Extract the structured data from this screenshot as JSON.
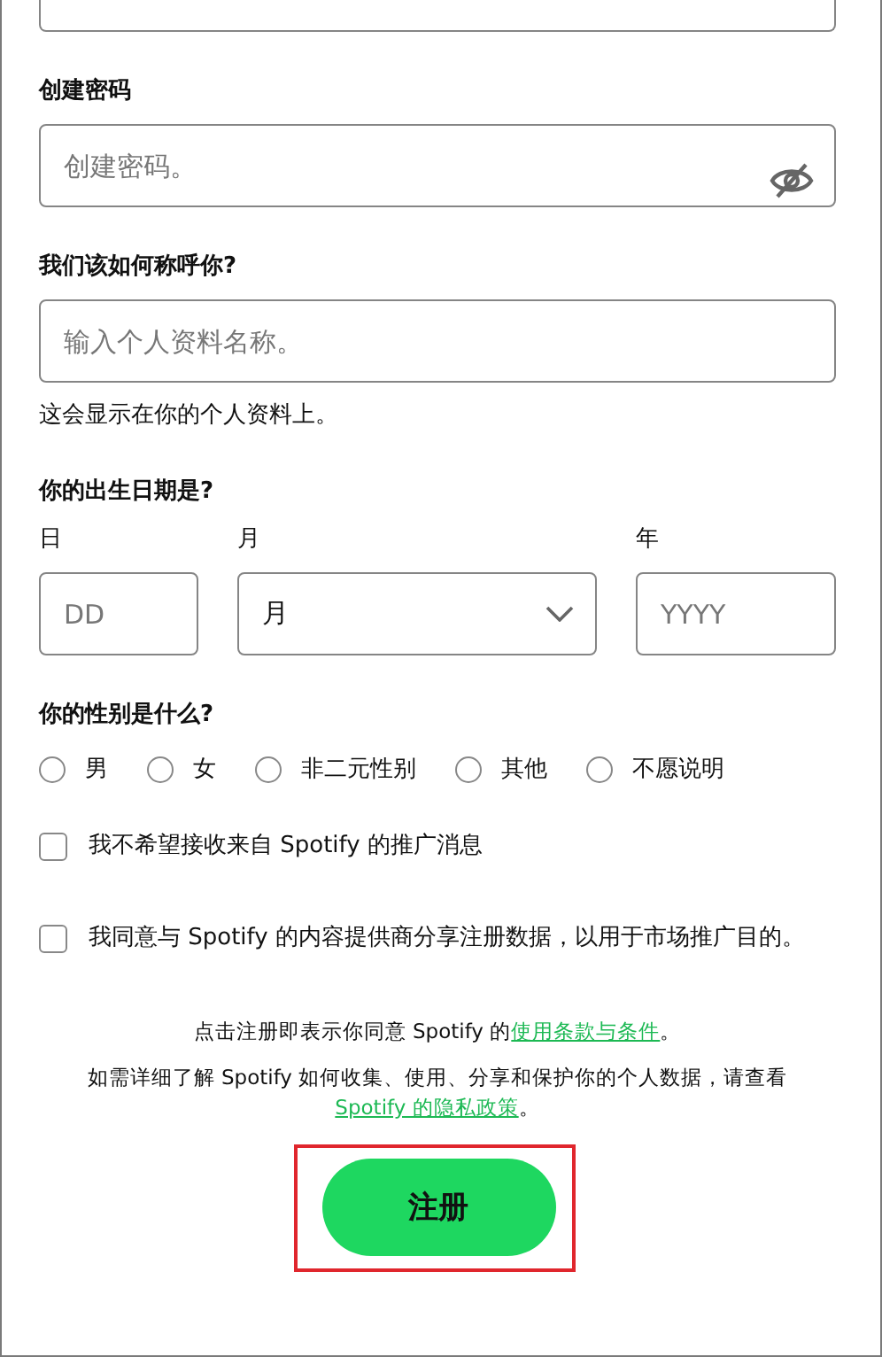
{
  "password": {
    "label": "创建密码",
    "placeholder": "创建密码。"
  },
  "profile_name": {
    "label": "我们该如何称呼你?",
    "placeholder": "输入个人资料名称。",
    "hint": "这会显示在你的个人资料上。"
  },
  "birth_date": {
    "label": "你的出生日期是?",
    "day": {
      "label": "日",
      "placeholder": "DD"
    },
    "month": {
      "label": "月",
      "value": "月"
    },
    "year": {
      "label": "年",
      "placeholder": "YYYY"
    }
  },
  "gender": {
    "label": "你的性别是什么?",
    "options": [
      {
        "label": "男",
        "selected": false
      },
      {
        "label": "女",
        "selected": false
      },
      {
        "label": "非二元性别",
        "selected": false
      },
      {
        "label": "其他",
        "selected": false
      },
      {
        "label": "不愿说明",
        "selected": false
      }
    ]
  },
  "checkboxes": [
    {
      "label": "我不希望接收来自 Spotify 的推广消息",
      "checked": false
    },
    {
      "label": "我同意与 Spotify 的内容提供商分享注册数据，以用于市场推广目的。",
      "checked": false
    }
  ],
  "terms": {
    "text": "点击注册即表示你同意 Spotify 的",
    "link": "使用条款与条件",
    "after": "。"
  },
  "privacy": {
    "text": "如需详细了解 Spotify 如何收集、使用、分享和保护你的个人数据，请查看 ",
    "link": "Spotify 的隐私政策",
    "after": "。"
  },
  "submit": {
    "label": "注册",
    "highlighted": true
  }
}
